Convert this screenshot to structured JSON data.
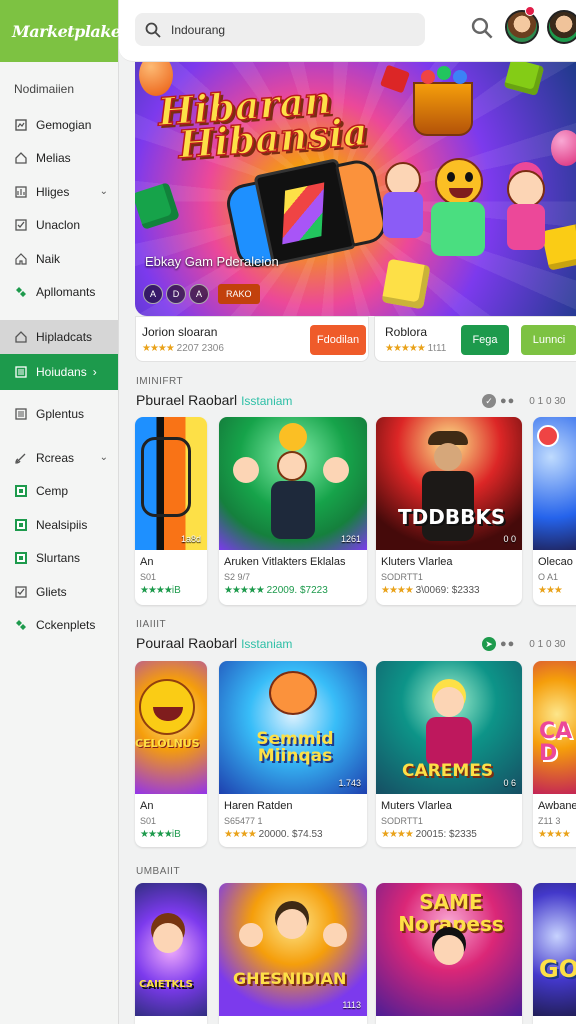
{
  "brand": {
    "name": "Marketplake"
  },
  "sidebar": {
    "section": "Nodimaiien",
    "items": [
      {
        "label": "Gemogian",
        "icon": "grid-icon"
      },
      {
        "label": "Melias",
        "icon": "home-icon"
      },
      {
        "label": "Hliges",
        "icon": "image-icon",
        "chevron": true
      },
      {
        "label": "Unaclon",
        "icon": "check-square-icon"
      },
      {
        "label": "Naik",
        "icon": "home-outline-icon"
      },
      {
        "label": "Apllomants",
        "icon": "puzzle-icon"
      },
      {
        "label": "Hipladcats",
        "icon": "home-icon"
      },
      {
        "label": "Hoiudans",
        "icon": "list-icon"
      },
      {
        "label": "Gplentus",
        "icon": "lines-icon"
      },
      {
        "label": "Rcreas",
        "icon": "brush-icon",
        "chevron": true
      },
      {
        "label": "Cemp",
        "icon": "square-green-icon"
      },
      {
        "label": "Nealsipiis",
        "icon": "square-green-icon"
      },
      {
        "label": "Slurtans",
        "icon": "square-green-icon"
      },
      {
        "label": "Gliets",
        "icon": "check-square-icon"
      },
      {
        "label": "Cckenplets",
        "icon": "diamond-icon"
      }
    ]
  },
  "search": {
    "value": "Indourang"
  },
  "hero": {
    "title_line1": "Hibaran",
    "title_line2": "Hibansia",
    "subtitle": "Ebkay Gam Pderaleion",
    "controls": [
      "A",
      "D",
      "A"
    ],
    "tag": "RAKO"
  },
  "featured": [
    {
      "title": "Jorion sloaran",
      "rating": "★★★★",
      "meta": "2207 2306",
      "button": "Fdodilan",
      "button_color": "#ef5b2a"
    },
    {
      "title": "Roblora",
      "rating": "★★★★★",
      "meta": "1t11",
      "button": "Fega",
      "button_color": "#1d9a4c",
      "button2": "Lunnci",
      "button2_color": "#7dc242"
    }
  ],
  "sections": [
    {
      "small": "IMINIFRT",
      "title": "Pburael Raobarl",
      "accent": "Isstaniam",
      "ctrl_text": "0 1 0 30",
      "cards": [
        {
          "name": "An",
          "sub": "S01",
          "rating": "★★★★",
          "meta": "iB",
          "badge": "1a8d",
          "art": "controller"
        },
        {
          "name": "Aruken Vitlakters Eklalas",
          "sub": "S2 9/7",
          "rating": "★★★★★",
          "meta": "22009. $7223",
          "badge": "1261",
          "art": "adventure"
        },
        {
          "name": "Kluters Vlarlea",
          "sub": "SODRTT1",
          "rating": "★★★★",
          "meta": "3\\0069: $2333",
          "badge": "0 0",
          "art": "cowboy",
          "label": "TDDBBKS"
        },
        {
          "name": "Olecao",
          "sub": "O A1",
          "rating": "★★★",
          "meta": "",
          "badge": "",
          "art": "fairy"
        }
      ]
    },
    {
      "small": "IIAIIIT",
      "title": "Pouraal Raobarl",
      "accent": "Isstaniam",
      "ctrl_text": "0 1 0 30",
      "cards": [
        {
          "name": "An",
          "sub": "S01",
          "rating": "★★★★",
          "meta": "iB",
          "badge": "",
          "art": "emoji",
          "label": "CELOLNUS"
        },
        {
          "name": "Haren Ratden",
          "sub": "S65477 1",
          "rating": "★★★★",
          "meta": "20000. $74.53",
          "badge": "1.743",
          "art": "cat",
          "label": "Semmid Miinqas"
        },
        {
          "name": "Muters Vlarlea",
          "sub": "SODRTT1",
          "rating": "★★★★",
          "meta": "20015: $2335",
          "badge": "0 6",
          "art": "hero",
          "label": "CAREMES"
        },
        {
          "name": "Awbane",
          "sub": "Z11 3",
          "rating": "★★★★",
          "meta": "",
          "badge": "",
          "art": "candy",
          "label": "CA D"
        }
      ]
    },
    {
      "small": "UMBAIIT",
      "cards": [
        {
          "art": "party",
          "label": "CAIETKLS",
          "badge": ""
        },
        {
          "art": "group",
          "label": "GHESNIDIAN",
          "badge": "1113"
        },
        {
          "art": "same",
          "label": "SAME Norapess",
          "badge": ""
        },
        {
          "art": "space",
          "label": "GO",
          "badge": ""
        }
      ]
    }
  ],
  "colors": {
    "brand": "#7dc242",
    "accent_green": "#1d9a4c",
    "orange": "#ef5b2a",
    "teal": "#2dbfa6"
  }
}
